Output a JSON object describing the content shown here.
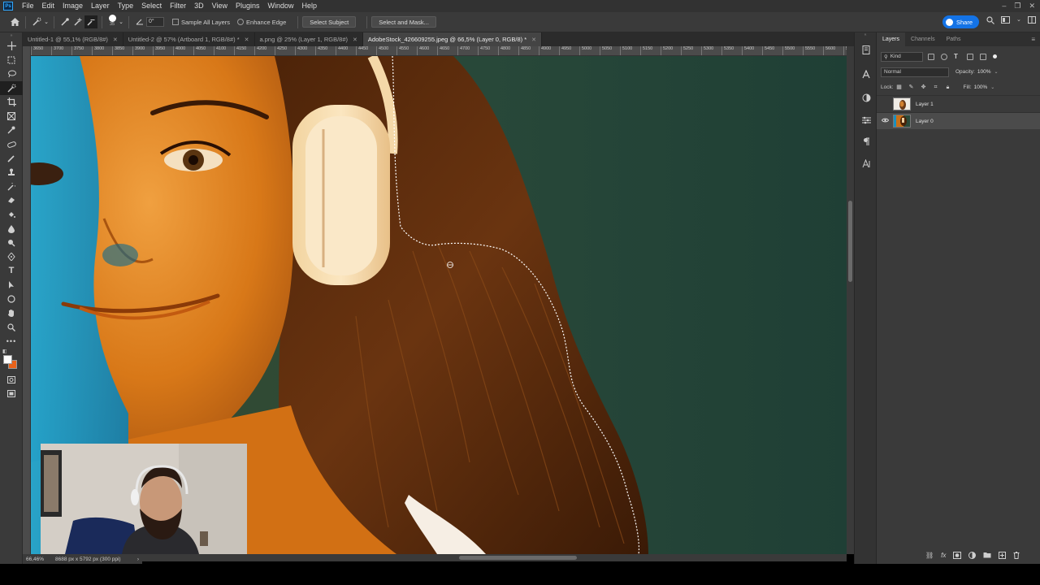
{
  "app": {
    "logo": "Ps",
    "menu": [
      "File",
      "Edit",
      "Image",
      "Layer",
      "Type",
      "Select",
      "Filter",
      "3D",
      "View",
      "Plugins",
      "Window",
      "Help"
    ],
    "window_controls": [
      "–",
      "❐",
      "✕"
    ]
  },
  "options": {
    "brush_size": "35",
    "angle": "0°",
    "sample_all_layers": "Sample All Layers",
    "enhance_edge": "Enhance Edge",
    "select_subject": "Select Subject",
    "select_and_mask": "Select and Mask...",
    "share": "Share"
  },
  "tabs": [
    {
      "label": "Untitled-1 @ 55,1% (RGB/8#)",
      "active": false
    },
    {
      "label": "Untitled-2 @ 57% (Artboard 1, RGB/8#) *",
      "active": false
    },
    {
      "label": "a.png @ 25% (Layer 1, RGB/8#)",
      "active": false
    },
    {
      "label": "AdobeStock_426609255.jpeg @ 66,5% (Layer 0, RGB/8) *",
      "active": true
    }
  ],
  "ruler": [
    "3650",
    "3700",
    "3750",
    "3800",
    "3850",
    "3900",
    "3950",
    "4000",
    "4050",
    "4100",
    "4150",
    "4200",
    "4250",
    "4300",
    "4350",
    "4400",
    "4450",
    "4500",
    "4550",
    "4600",
    "4650",
    "4700",
    "4750",
    "4800",
    "4850",
    "4900",
    "4950",
    "5000",
    "5050",
    "5100",
    "5150",
    "5200",
    "5250",
    "5300",
    "5350",
    "5400",
    "5450",
    "5500",
    "5550",
    "5600",
    "5650",
    "5700",
    "5750",
    "5800",
    "5850"
  ],
  "status": {
    "zoom": "66,46%",
    "doc_info": "8688 px x 5792 px (300 ppi)"
  },
  "colors": {
    "foreground": "#ffffff",
    "background": "#e8621a",
    "accent": "#1473e6"
  },
  "layers_panel": {
    "tabs": [
      "Layers",
      "Channels",
      "Paths"
    ],
    "filter_kind": "Kind",
    "blend_mode": "Normal",
    "opacity_label": "Opacity:",
    "opacity": "100%",
    "lock_label": "Lock:",
    "fill_label": "Fill:",
    "fill": "100%",
    "layers": [
      {
        "name": "Layer 1",
        "visible": false,
        "selected": false
      },
      {
        "name": "Layer 0",
        "visible": true,
        "selected": true
      }
    ]
  }
}
